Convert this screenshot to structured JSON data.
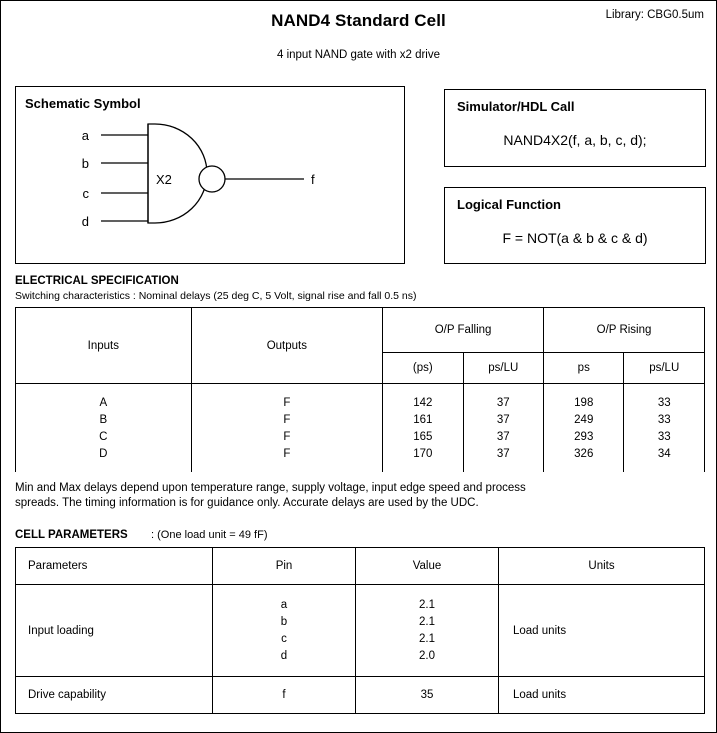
{
  "header": {
    "title": "NAND4 Standard Cell",
    "library": "Library: CBG0.5um",
    "subtitle": "4 input NAND gate with x2 drive"
  },
  "schematic": {
    "title": "Schematic Symbol",
    "drive_label": "X2",
    "inputs": [
      "a",
      "b",
      "c",
      "d"
    ],
    "output": "f"
  },
  "hdl": {
    "title": "Simulator/HDL Call",
    "call": "NAND4X2(f, a, b, c, d);"
  },
  "logic": {
    "title": "Logical Function",
    "expression": "F = NOT(a & b & c & d)"
  },
  "electrical": {
    "heading": "ELECTRICAL SPECIFICATION",
    "subheading": "Switching characteristics : Nominal delays (25 deg C, 5 Volt, signal rise and fall 0.5 ns)",
    "group_headers": {
      "inputs": "Inputs",
      "outputs": "Outputs",
      "falling": "O/P Falling",
      "rising": "O/P Rising"
    },
    "unit_headers": {
      "falling_ps": "(ps)",
      "falling_pslu": "ps/LU",
      "rising_ps": "ps",
      "rising_pslu": "ps/LU"
    },
    "rows": [
      {
        "input": "A",
        "output": "F",
        "falling_ps": "142",
        "falling_pslu": "37",
        "rising_ps": "198",
        "rising_pslu": "33"
      },
      {
        "input": "B",
        "output": "F",
        "falling_ps": "161",
        "falling_pslu": "37",
        "rising_ps": "249",
        "rising_pslu": "33"
      },
      {
        "input": "C",
        "output": "F",
        "falling_ps": "165",
        "falling_pslu": "37",
        "rising_ps": "293",
        "rising_pslu": "33"
      },
      {
        "input": "D",
        "output": "F",
        "falling_ps": "170",
        "falling_pslu": "37",
        "rising_ps": "326",
        "rising_pslu": "34"
      }
    ],
    "note_line1": "Min and Max delays depend upon temperature range, supply voltage, input edge speed and process",
    "note_line2": "spreads.  The timing information is for guidance only.  Accurate delays are used by the UDC."
  },
  "cell_parameters": {
    "heading": "CELL PARAMETERS",
    "heading_note": ": (One load unit = 49 fF)",
    "columns": {
      "parameters": "Parameters",
      "pin": "Pin",
      "value": "Value",
      "units": "Units"
    },
    "rows": [
      {
        "parameter": "Input loading",
        "pins": [
          "a",
          "b",
          "c",
          "d"
        ],
        "values": [
          "2.1",
          "2.1",
          "2.1",
          "2.0"
        ],
        "units": "Load units"
      },
      {
        "parameter": "Drive capability",
        "pins": [
          "f"
        ],
        "values": [
          "35"
        ],
        "units": "Load units"
      }
    ]
  },
  "colors": {
    "ink": "#000000",
    "paper": "#ffffff"
  }
}
